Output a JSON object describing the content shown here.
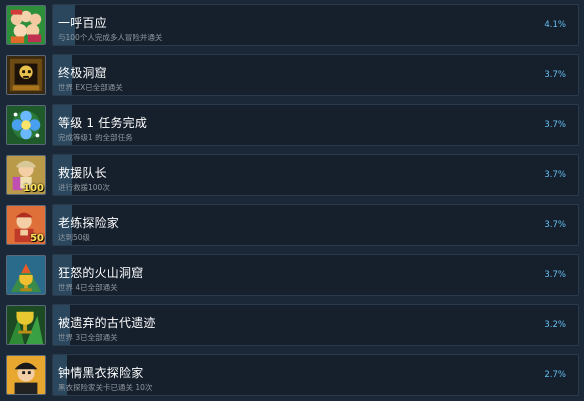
{
  "achievements": [
    {
      "title": "一呼百应",
      "desc": "与100个人完成多人冒险并通关",
      "percent": "4.1%",
      "fill": 0.041,
      "icon": "crowd-icon",
      "badge": ""
    },
    {
      "title": "终极洞窟",
      "desc": "世界 EX已全部通关",
      "percent": "3.7%",
      "fill": 0.037,
      "icon": "cave-skull-icon",
      "badge": ""
    },
    {
      "title": "等级 1 任务完成",
      "desc": "完成等级1 的全部任务",
      "percent": "3.7%",
      "fill": 0.037,
      "icon": "blue-flower-icon",
      "badge": ""
    },
    {
      "title": "救援队长",
      "desc": "进行救援100次",
      "percent": "3.7%",
      "fill": 0.037,
      "icon": "rescue-explorer-icon",
      "badge": "100"
    },
    {
      "title": "老练探险家",
      "desc": "达到50级",
      "percent": "3.7%",
      "fill": 0.037,
      "icon": "veteran-explorer-icon",
      "badge": "50"
    },
    {
      "title": "狂怒的火山洞窟",
      "desc": "世界 4已全部通关",
      "percent": "3.7%",
      "fill": 0.037,
      "icon": "volcano-trophy-icon",
      "badge": ""
    },
    {
      "title": "被遗弃的古代遗迹",
      "desc": "世界 3已全部通关",
      "percent": "3.2%",
      "fill": 0.032,
      "icon": "ruins-trophy-icon",
      "badge": ""
    },
    {
      "title": "钟情黑衣探险家",
      "desc": "黑衣探险家关卡已通关 10次",
      "percent": "2.7%",
      "fill": 0.027,
      "icon": "black-explorer-icon",
      "badge": ""
    }
  ]
}
